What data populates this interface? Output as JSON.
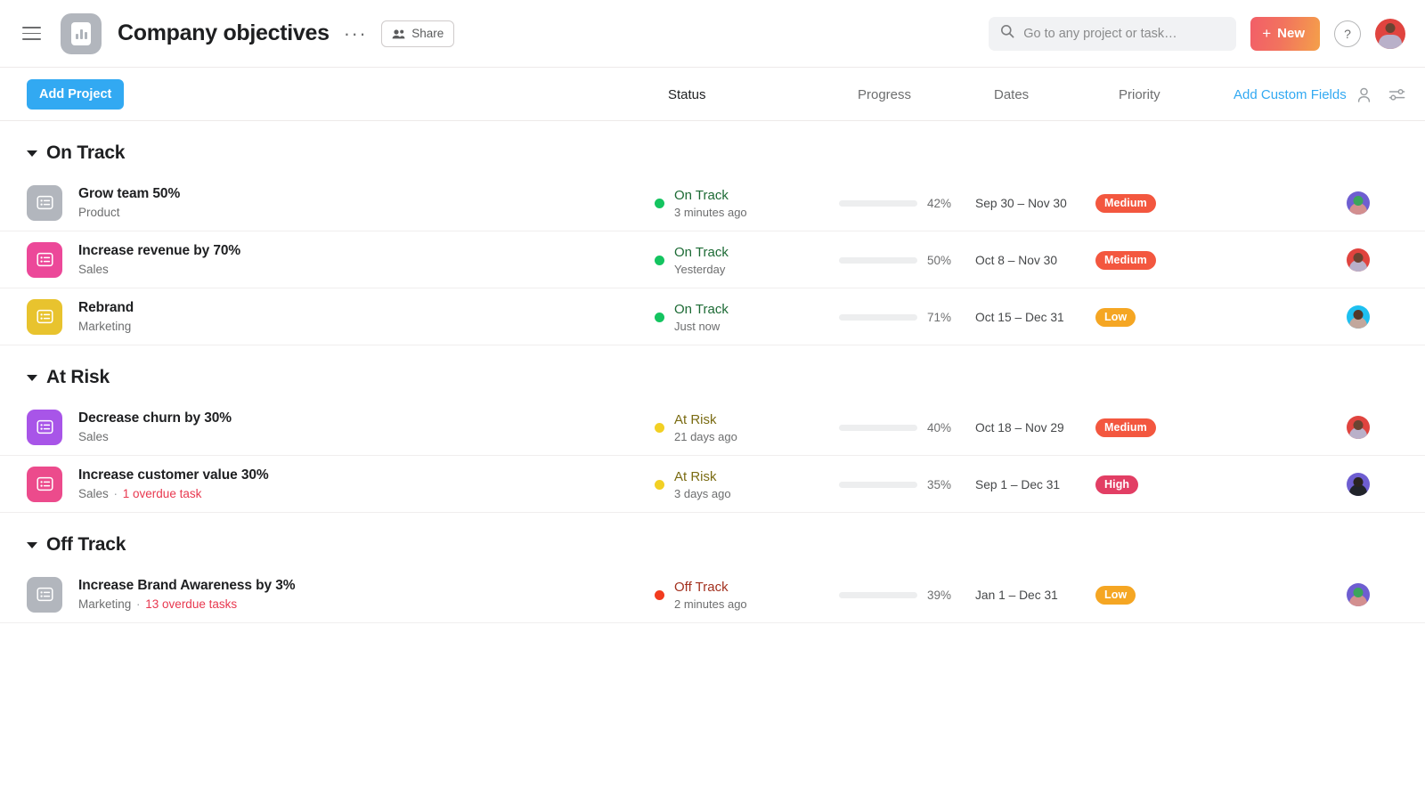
{
  "topbar": {
    "menu_icon": "hamburger-icon",
    "logo_icon": "project-bar-chart-icon",
    "title": "Company objectives",
    "more_label": "···",
    "share_label": "Share",
    "share_icon": "people-icon",
    "search": {
      "placeholder": "Go to any project or task…",
      "value": "",
      "icon": "search-icon"
    },
    "new_button": {
      "label": "New",
      "plus": "+",
      "gradient_from": "#f25e68",
      "gradient_to": "#f4a04a"
    },
    "help_label": "?",
    "avatar": {
      "name": "user-avatar",
      "bg": "#e0443f"
    }
  },
  "toolbar": {
    "add_project_label": "Add Project",
    "add_project_color": "#32a9f2",
    "columns": [
      {
        "label": "Status",
        "strong": true
      },
      {
        "label": "Progress",
        "strong": false
      },
      {
        "label": "Dates",
        "strong": false
      },
      {
        "label": "Priority",
        "strong": false
      }
    ],
    "add_custom_fields_label": "Add Custom Fields",
    "add_custom_fields_color": "#32a9f2",
    "person_icon": "person-icon",
    "filter_icon": "filter-sliders-icon"
  },
  "groups": [
    {
      "title": "On Track",
      "rows": [
        {
          "name": "Grow team 50%",
          "team": "Product",
          "overdue": "",
          "icon_color": "#b2b6bd",
          "status": {
            "label": "On Track",
            "time": "3 minutes ago",
            "dot": "#14c460",
            "text_color": "#1d6b35"
          },
          "progress": {
            "pct": "42%",
            "value": 42,
            "fill": "#3ecfd6"
          },
          "dates": "Sep 30 – Nov 30",
          "priority": {
            "label": "Medium",
            "color": "#f3573f"
          },
          "avatar": {
            "bg": "#6e5ed1",
            "head": "#3ba55c",
            "body": "#d38f8f"
          }
        },
        {
          "name": "Increase revenue by 70%",
          "team": "Sales",
          "overdue": "",
          "icon_color": "#ec4899",
          "status": {
            "label": "On Track",
            "time": "Yesterday",
            "dot": "#14c460",
            "text_color": "#1d6b35"
          },
          "progress": {
            "pct": "50%",
            "value": 50,
            "fill": "#3ecfd6"
          },
          "dates": "Oct 8 – Nov 30",
          "priority": {
            "label": "Medium",
            "color": "#f3573f"
          },
          "avatar": {
            "bg": "#e0443f",
            "head": "#6a4432",
            "body": "#b9b0c9"
          }
        },
        {
          "name": "Rebrand",
          "team": "Marketing",
          "overdue": "",
          "icon_color": "#e8c32e",
          "status": {
            "label": "On Track",
            "time": "Just now",
            "dot": "#14c460",
            "text_color": "#1d6b35"
          },
          "progress": {
            "pct": "71%",
            "value": 71,
            "fill": "#3ecfd6"
          },
          "dates": "Oct 15 – Dec 31",
          "priority": {
            "label": "Low",
            "color": "#f5a623"
          },
          "avatar": {
            "bg": "#1ec0f0",
            "head": "#53382a",
            "body": "#c2a79c"
          }
        }
      ]
    },
    {
      "title": "At Risk",
      "rows": [
        {
          "name": "Decrease churn by 30%",
          "team": "Sales",
          "overdue": "",
          "icon_color": "#a855e8",
          "status": {
            "label": "At Risk",
            "time": "21 days ago",
            "dot": "#f2d024",
            "text_color": "#7a6b12"
          },
          "progress": {
            "pct": "40%",
            "value": 40,
            "fill": "#3ecfd6"
          },
          "dates": "Oct 18 – Nov 29",
          "priority": {
            "label": "Medium",
            "color": "#f3573f"
          },
          "avatar": {
            "bg": "#e0443f",
            "head": "#6a4432",
            "body": "#b9b0c9"
          }
        },
        {
          "name": "Increase customer value 30%",
          "team": "Sales",
          "overdue": "1 overdue task",
          "icon_color": "#ec4b8c",
          "status": {
            "label": "At Risk",
            "time": "3 days ago",
            "dot": "#f2d024",
            "text_color": "#7a6b12"
          },
          "progress": {
            "pct": "35%",
            "value": 35,
            "fill": "#3ecfd6"
          },
          "dates": "Sep 1 – Dec 31",
          "priority": {
            "label": "High",
            "color": "#e23e64"
          },
          "avatar": {
            "bg": "#6e5ed1",
            "head": "#2b2420",
            "body": "#21242a"
          }
        }
      ]
    },
    {
      "title": "Off Track",
      "rows": [
        {
          "name": "Increase Brand Awareness by 3%",
          "team": "Marketing",
          "overdue": "13 overdue tasks",
          "icon_color": "#b2b6bd",
          "status": {
            "label": "Off Track",
            "time": "2 minutes ago",
            "dot": "#f23c1f",
            "text_color": "#a3311f"
          },
          "progress": {
            "pct": "39%",
            "value": 39,
            "fill": "#3ecfd6"
          },
          "dates": "Jan 1 – Dec 31",
          "priority": {
            "label": "Low",
            "color": "#f5a623"
          },
          "avatar": {
            "bg": "#6e5ed1",
            "head": "#3ba55c",
            "body": "#d38f8f"
          }
        }
      ]
    }
  ]
}
